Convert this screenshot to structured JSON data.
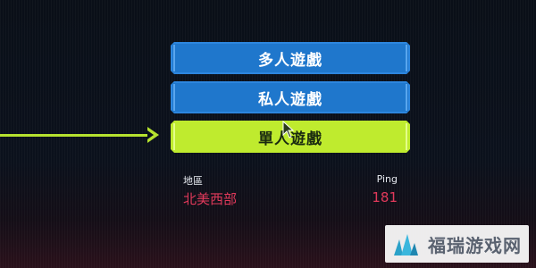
{
  "menu": {
    "items": [
      {
        "label": "多人遊戲",
        "style": "blue"
      },
      {
        "label": "私人遊戲",
        "style": "blue"
      },
      {
        "label": "單人遊戲",
        "style": "green",
        "selected": true
      }
    ]
  },
  "server_info": {
    "region_label": "地區",
    "region_value": "北美西部",
    "ping_label": "Ping",
    "ping_value": "181"
  },
  "colors": {
    "primary_button": "#1f77cc",
    "selected_button": "#bfeb2e",
    "arrow": "#b6e22f",
    "value_text": "#e0395a"
  },
  "watermark": {
    "text": "福瑞游戏网"
  }
}
